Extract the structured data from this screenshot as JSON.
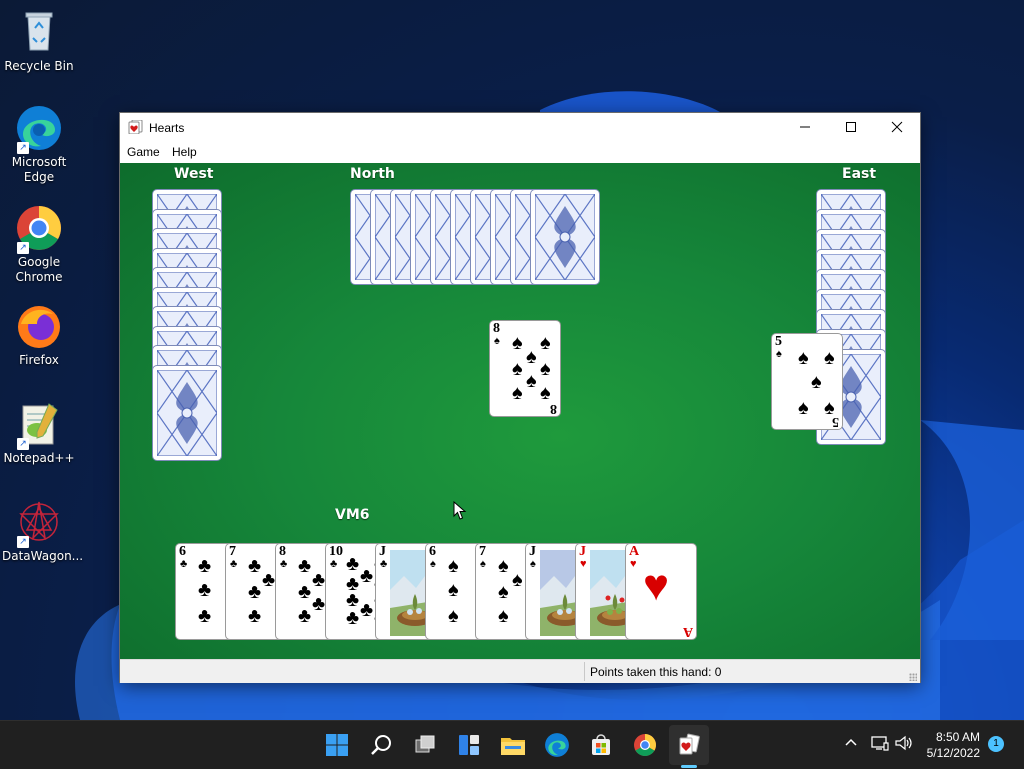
{
  "desktop": {
    "icons": [
      {
        "label": "Recycle Bin"
      },
      {
        "label": "Microsoft Edge"
      },
      {
        "label": "Google Chrome"
      },
      {
        "label": "Firefox"
      },
      {
        "label": "Notepad++"
      },
      {
        "label": "DataWagon..."
      }
    ]
  },
  "window": {
    "title": "Hearts",
    "menu": [
      "Game",
      "Help"
    ],
    "status": "Points taken this hand: 0"
  },
  "game": {
    "players": {
      "west": "West",
      "north": "North",
      "east": "East",
      "south": "VM6"
    },
    "played": {
      "north": {
        "rank": "8",
        "suit": "spades"
      },
      "east": {
        "rank": "5",
        "suit": "spades"
      }
    },
    "hand": [
      {
        "rank": "6",
        "suit": "clubs"
      },
      {
        "rank": "7",
        "suit": "clubs"
      },
      {
        "rank": "8",
        "suit": "clubs"
      },
      {
        "rank": "10",
        "suit": "clubs"
      },
      {
        "rank": "J",
        "suit": "clubs"
      },
      {
        "rank": "6",
        "suit": "spades"
      },
      {
        "rank": "7",
        "suit": "spades"
      },
      {
        "rank": "J",
        "suit": "spades"
      },
      {
        "rank": "J",
        "suit": "hearts"
      },
      {
        "rank": "A",
        "suit": "hearts"
      }
    ]
  },
  "taskbar": {
    "time": "8:50 AM",
    "date": "5/12/2022",
    "notifications": "1",
    "apps": [
      "start-icon",
      "search-icon",
      "task-view-icon",
      "widgets-icon",
      "file-explorer-icon",
      "edge-icon",
      "store-icon",
      "chrome-icon",
      "hearts-icon"
    ]
  }
}
